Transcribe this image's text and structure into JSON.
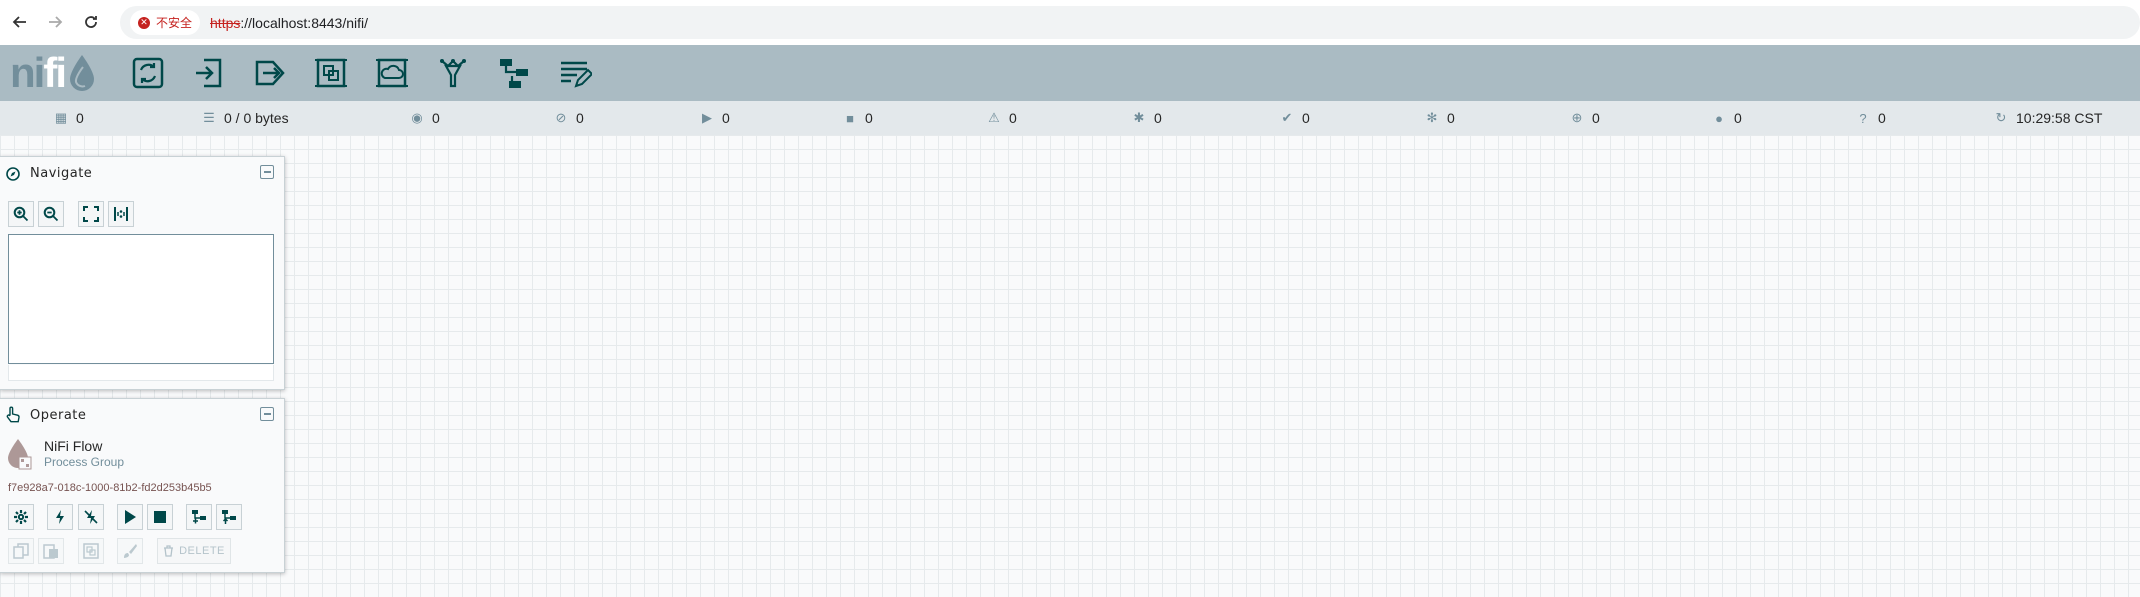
{
  "browser": {
    "security_label": "不安全",
    "url_scheme": "https",
    "url_rest": "://localhost:8443/nifi/"
  },
  "logo": {
    "text_ni": "ni",
    "text_fi": "fi"
  },
  "toolbar": {
    "items": [
      "processor",
      "input-port",
      "output-port",
      "process-group",
      "remote-process-group",
      "funnel",
      "template",
      "label"
    ]
  },
  "stats": {
    "active_threads": "0",
    "queued": "0 / 0 bytes",
    "transmitting": "0",
    "not_transmitting": "0",
    "running": "0",
    "stopped": "0",
    "invalid": "0",
    "disabled": "0",
    "up_to_date": "0",
    "locally_modified": "0",
    "stale": "0",
    "locally_modified_stale": "0",
    "sync_failure": "0",
    "refresh_time": "10:29:58 CST"
  },
  "navigate": {
    "title": "Navigate"
  },
  "operate": {
    "title": "Operate",
    "component_name": "NiFi Flow",
    "component_type": "Process Group",
    "component_id": "f7e928a7-018c-1000-81b2-fd2d253b45b5",
    "delete_label": "DELETE"
  },
  "colors": {
    "header": "#aabbc3",
    "accent": "#004849",
    "stats_bg": "#e3e8eb"
  }
}
